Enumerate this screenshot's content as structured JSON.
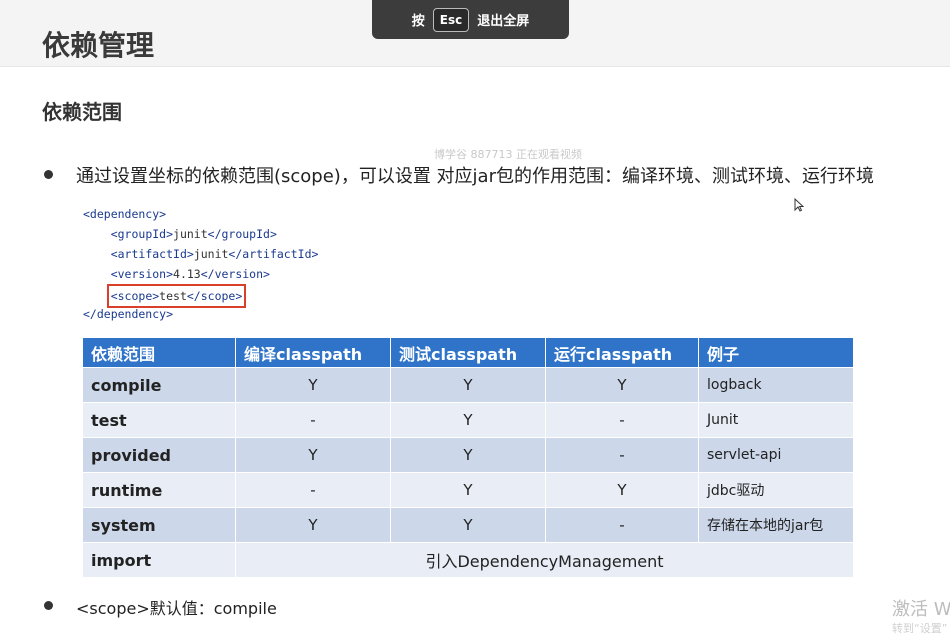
{
  "slide": {
    "title": "依赖管理",
    "subtitle": "依赖范围",
    "bullet1": "通过设置坐标的依赖范围(scope)，可以设置 对应jar包的作用范围：编译环境、测试环境、运行环境",
    "bullet2": "<scope>默认值：compile"
  },
  "overlay": {
    "press_label": "按",
    "esc_key": "Esc",
    "exit_label": "退出全屏",
    "watermark": "博学谷 887713 正在观看视频",
    "activate_text": "激活 W",
    "activate_sub": "转到“设置”"
  },
  "code": {
    "l1_open": "<dependency>",
    "l2": {
      "open": "<groupId>",
      "text": "junit",
      "close": "</groupId>"
    },
    "l3": {
      "open": "<artifactId>",
      "text": "junit",
      "close": "</artifactId>"
    },
    "l4": {
      "open": "<version>",
      "text": "4.13",
      "close": "</version>"
    },
    "l5": {
      "open": "<scope>",
      "text": "test",
      "close": "</scope>"
    },
    "l6_close": "</dependency>"
  },
  "table": {
    "headers": [
      "依赖范围",
      "编译classpath",
      "测试classpath",
      "运行classpath",
      "例子"
    ],
    "rows": [
      {
        "name": "compile",
        "compile": "Y",
        "test": "Y",
        "runtime": "Y",
        "example": "logback"
      },
      {
        "name": "test",
        "compile": "-",
        "test": "Y",
        "runtime": "-",
        "example": "Junit"
      },
      {
        "name": "provided",
        "compile": "Y",
        "test": "Y",
        "runtime": "-",
        "example": "servlet-api"
      },
      {
        "name": "runtime",
        "compile": "-",
        "test": "Y",
        "runtime": "Y",
        "example": "jdbc驱动"
      },
      {
        "name": "system",
        "compile": "Y",
        "test": "Y",
        "runtime": "-",
        "example": "存储在本地的jar包"
      },
      {
        "name": "import",
        "merged": "引入DependencyManagement"
      }
    ]
  }
}
